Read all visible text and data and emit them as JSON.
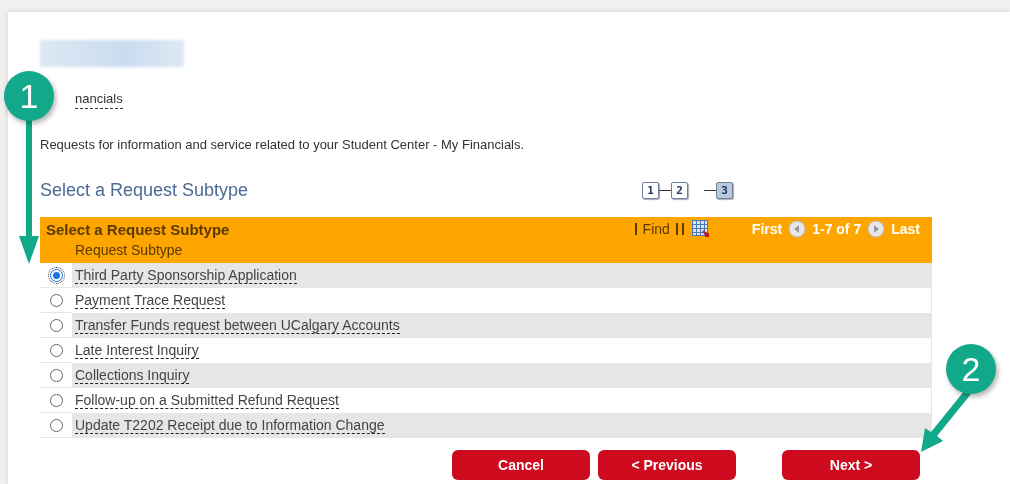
{
  "breadcrumb_link": "nancials",
  "description": "Requests for information and service related to your Student Center - My Financials.",
  "heading": "Select a Request Subtype",
  "steps": [
    {
      "label": "1",
      "selected": false
    },
    {
      "label": "2",
      "selected": false
    },
    {
      "label": "3",
      "selected": true
    }
  ],
  "grid": {
    "title": "Select a Request Subtype",
    "find": "Find",
    "first": "First",
    "range": "1-7 of 7",
    "last": "Last",
    "column": "Request Subtype",
    "rows": [
      {
        "label": "Third Party Sponsorship Application",
        "selected": true
      },
      {
        "label": "Payment Trace Request",
        "selected": false
      },
      {
        "label": "Transfer Funds request between UCalgary Accounts",
        "selected": false
      },
      {
        "label": "Late Interest Inquiry",
        "selected": false
      },
      {
        "label": "Collections Inquiry",
        "selected": false
      },
      {
        "label": "Follow-up on a Submitted Refund Request",
        "selected": false
      },
      {
        "label": "Update T2202 Receipt due to Information Change",
        "selected": false
      }
    ]
  },
  "buttons": [
    {
      "label": "Cancel"
    },
    {
      "label": "< Previous"
    },
    {
      "label": "Next >"
    }
  ],
  "annotations": [
    {
      "label": "1"
    },
    {
      "label": "2"
    }
  ]
}
